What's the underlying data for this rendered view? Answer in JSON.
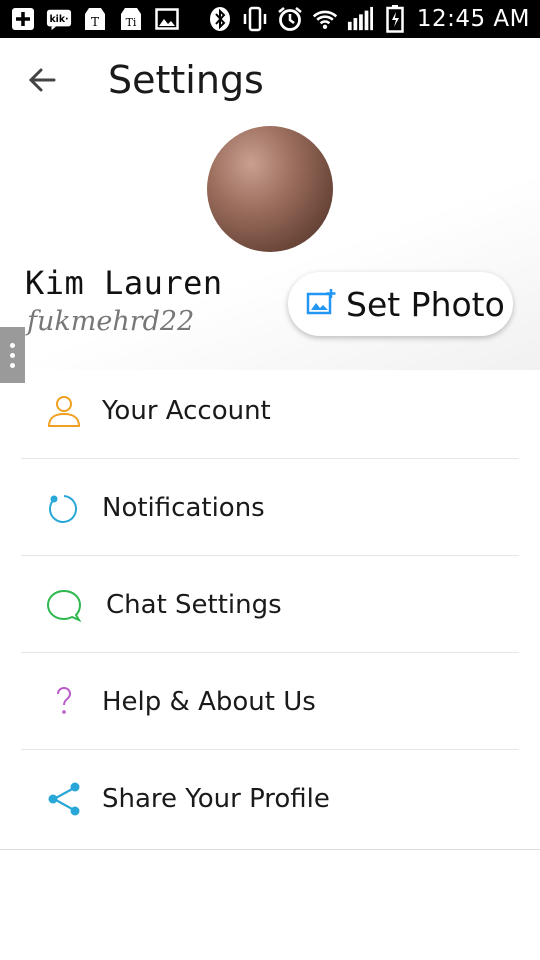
{
  "status_bar": {
    "time": "12:45 AM",
    "left_icons": [
      "plus-icon",
      "kik-icon",
      "text-tag-icon",
      "text-tag-icon",
      "image-icon"
    ],
    "right_icons": [
      "bluetooth-icon",
      "vibrate-icon",
      "alarm-icon",
      "wifi-icon",
      "signal-icon",
      "battery-icon"
    ]
  },
  "header": {
    "title": "Settings",
    "back_icon": "arrow-left-icon"
  },
  "profile": {
    "name": "Kim Lauren",
    "username": "fukmehrd22",
    "set_photo_label": "Set Photo"
  },
  "menu": {
    "items": [
      {
        "label": "Your Account",
        "icon": "person-icon",
        "color": "#f0a020"
      },
      {
        "label": "Notifications",
        "icon": "notification-icon",
        "color": "#29a8d8"
      },
      {
        "label": "Chat Settings",
        "icon": "chat-bubble-icon",
        "color": "#2fb84e"
      },
      {
        "label": "Help & About Us",
        "icon": "question-icon",
        "color": "#b85bc9"
      },
      {
        "label": "Share Your Profile",
        "icon": "share-icon",
        "color": "#29a8d8"
      }
    ]
  },
  "colors": {
    "status_bar": "#000000",
    "background": "#ffffff",
    "set_photo_icon": "#2196f3"
  }
}
